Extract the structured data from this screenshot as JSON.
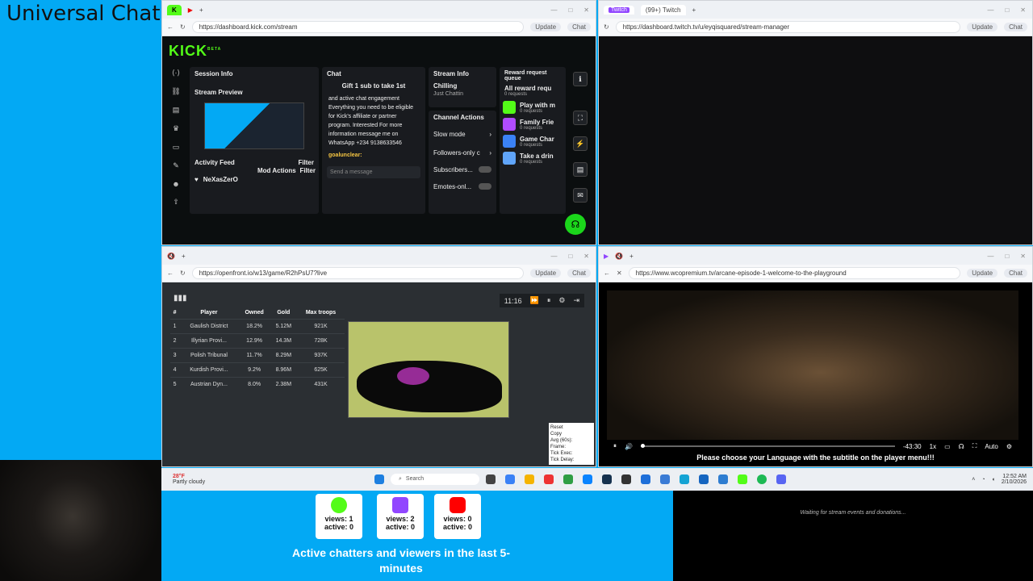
{
  "overlay_title": "Universal Chat",
  "kick_window": {
    "url": "https://dashboard.kick.com/stream",
    "logo": "KICK",
    "logo_sup": "BETA",
    "update_label": "Update",
    "chat_label": "Chat",
    "session_info": "Session Info",
    "stream_preview": "Stream Preview",
    "activity_feed": "Activity Feed",
    "filter": "Filter",
    "mod_actions": "Mod Actions",
    "follower_name": "NeXasZerO",
    "chat_title": "Chat",
    "gift_banner": "Gift 1 sub to take 1st",
    "chat_message": "and active chat engagement Everything you need to be eligible for Kick's affiliate or partner program. Interested For more information message me on WhatsApp +234 9138633546",
    "chat_user": "goalunclear:",
    "send_placeholder": "Send a message",
    "stream_info": "Stream Info",
    "stream_title": "Chilling",
    "stream_category": "Just Chattin",
    "channel_actions": "Channel Actions",
    "actions": [
      "Slow mode",
      "Followers-only c",
      "Subscribers...",
      "Emotes-onl..."
    ],
    "reward_queue": "Reward request queue",
    "all_rewards": "All reward requ",
    "rewards": [
      {
        "title": "Play with m",
        "count": "0 requests",
        "color": "#53fc18"
      },
      {
        "title": "Family Frie",
        "count": "0 requests",
        "color": "#b14cff"
      },
      {
        "title": "Game Char",
        "count": "0 requests",
        "color": "#3b82f6"
      },
      {
        "title": "Take a drin",
        "count": "0 requests",
        "color": "#60a5fa"
      }
    ],
    "all_rewards_count": "0 requests"
  },
  "twitch_window": {
    "tab_badge": "Twitch",
    "tab_title": "(99+) Twitch",
    "url": "https://dashboard.twitch.tv/u/eyqisquared/stream-manager",
    "update_label": "Update",
    "chat_label": "Chat"
  },
  "openfront_window": {
    "url": "https://openfront.io/w13/game/R2hPsU7?live",
    "update_label": "Update",
    "chat_label": "Chat",
    "timer": "11:16",
    "columns": [
      "#",
      "Player",
      "Owned",
      "Gold",
      "Max troops"
    ],
    "rows": [
      [
        "1",
        "Gaulish District",
        "18.2%",
        "5.12M",
        "921K"
      ],
      [
        "2",
        "Illyrian Provi...",
        "12.9%",
        "14.3M",
        "728K"
      ],
      [
        "3",
        "Polish Tribunal",
        "11.7%",
        "8.29M",
        "937K"
      ],
      [
        "4",
        "Kurdish Provi...",
        "9.2%",
        "8.96M",
        "625K"
      ],
      [
        "5",
        "Austrian Dyn...",
        "8.0%",
        "2.38M",
        "431K"
      ]
    ],
    "perf": [
      "Reset",
      "Copy",
      "Avg (60s):",
      "Frame:",
      "Tick Exec:",
      "Tick Delay:"
    ]
  },
  "video_window": {
    "url": "https://www.wcopremium.tv/arcane-episode-1-welcome-to-the-playground",
    "update_label": "Update",
    "chat_label": "Chat",
    "time_remaining": "-43:30",
    "speed": "1x",
    "quality": "Auto",
    "subtitle": "Please choose your Language with the subtitle on the player menu!!!"
  },
  "taskbar": {
    "weather_temp": "28°F",
    "weather_desc": "Partly cloudy",
    "search": "Search",
    "time": "12:52 AM",
    "date": "2/10/2026"
  },
  "stats": {
    "kick": {
      "views": "views: 1",
      "active": "active: 0",
      "color": "#53fc18"
    },
    "twitch": {
      "views": "views: 2",
      "active": "active: 0",
      "color": "#9146ff"
    },
    "youtube": {
      "views": "views: 0",
      "active": "active: 0",
      "color": "#ff0000"
    },
    "caption": "Active chatters and viewers in the last 5-minutes"
  },
  "events_text": "Waiting for stream events and donations..."
}
